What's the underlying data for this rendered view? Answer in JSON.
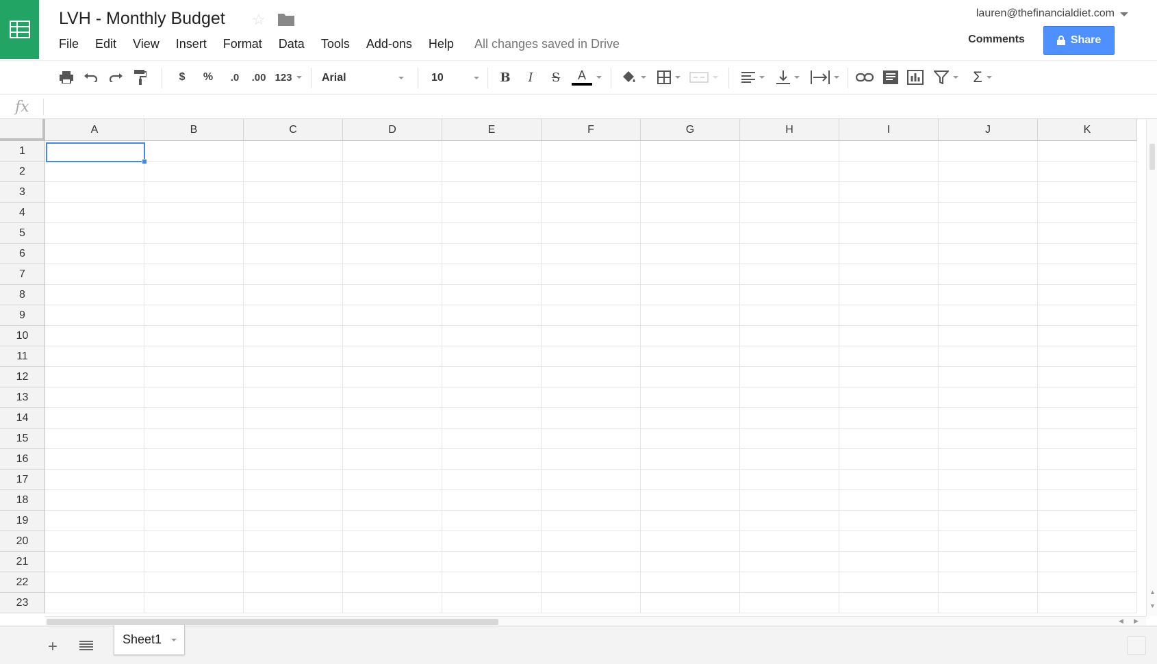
{
  "header": {
    "title": "LVH - Monthly Budget",
    "save_status": "All changes saved in Drive",
    "account": "lauren@thefinancialdiet.com",
    "comments_label": "Comments",
    "share_label": "Share"
  },
  "menu": [
    "File",
    "Edit",
    "View",
    "Insert",
    "Format",
    "Data",
    "Tools",
    "Add-ons",
    "Help"
  ],
  "toolbar": {
    "currency": "$",
    "percent": "%",
    "decrease_decimals": ".0",
    "increase_decimals": ".00",
    "more_formats": "123",
    "font": "Arial",
    "font_size": "10",
    "bold": "B",
    "italic": "I",
    "strikethrough": "S",
    "text_color_letter": "A",
    "text_color": "#000000"
  },
  "grid": {
    "columns": [
      "A",
      "B",
      "C",
      "D",
      "E",
      "F",
      "G",
      "H",
      "I",
      "J",
      "K"
    ],
    "rows": [
      "1",
      "2",
      "3",
      "4",
      "5",
      "6",
      "7",
      "8",
      "9",
      "10",
      "11",
      "12",
      "13",
      "14",
      "15",
      "16",
      "17",
      "18",
      "19",
      "20",
      "21",
      "22",
      "23"
    ],
    "selected_cell": "A1"
  },
  "sheets": {
    "tabs": [
      "Sheet1"
    ],
    "active": "Sheet1"
  },
  "colors": {
    "brand_green": "#21a464",
    "share_blue": "#4d90fe",
    "selection": "#4285f4"
  }
}
